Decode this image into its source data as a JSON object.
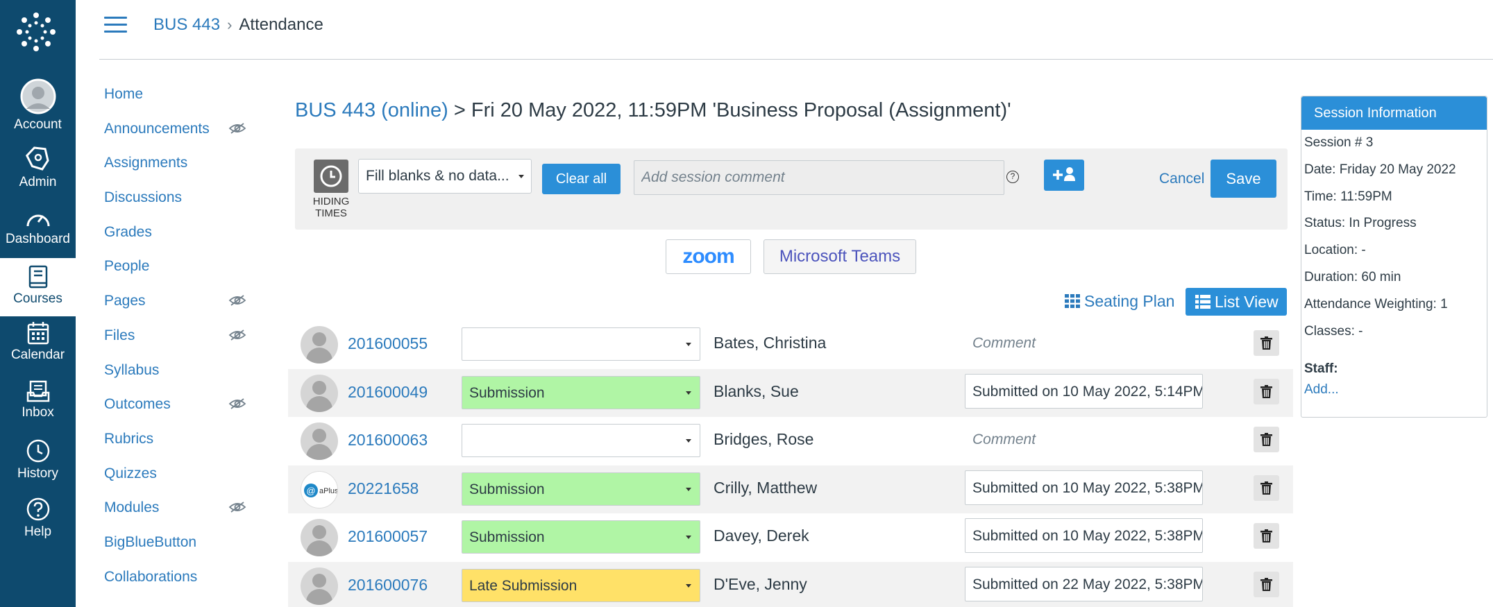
{
  "global_nav": {
    "items": [
      {
        "label": "Account",
        "icon": "account-avatar-icon"
      },
      {
        "label": "Admin",
        "icon": "admin-shield-icon"
      },
      {
        "label": "Dashboard",
        "icon": "dashboard-gauge-icon"
      },
      {
        "label": "Courses",
        "icon": "courses-book-icon",
        "active": true
      },
      {
        "label": "Calendar",
        "icon": "calendar-icon"
      },
      {
        "label": "Inbox",
        "icon": "inbox-icon"
      },
      {
        "label": "History",
        "icon": "history-clock-icon"
      },
      {
        "label": "Help",
        "icon": "help-question-icon"
      }
    ],
    "background": "#0e4a6e"
  },
  "header": {
    "course": "BUS 443",
    "separator": "›",
    "current": "Attendance"
  },
  "course_nav": {
    "items": [
      {
        "label": "Home",
        "hidden": false
      },
      {
        "label": "Announcements",
        "hidden": true
      },
      {
        "label": "Assignments",
        "hidden": false
      },
      {
        "label": "Discussions",
        "hidden": false
      },
      {
        "label": "Grades",
        "hidden": false
      },
      {
        "label": "People",
        "hidden": false
      },
      {
        "label": "Pages",
        "hidden": true
      },
      {
        "label": "Files",
        "hidden": true
      },
      {
        "label": "Syllabus",
        "hidden": false
      },
      {
        "label": "Outcomes",
        "hidden": true
      },
      {
        "label": "Rubrics",
        "hidden": false
      },
      {
        "label": "Quizzes",
        "hidden": false
      },
      {
        "label": "Modules",
        "hidden": true
      },
      {
        "label": "BigBlueButton",
        "hidden": false
      },
      {
        "label": "Collaborations",
        "hidden": false
      }
    ]
  },
  "main": {
    "title_link": "BUS 443 (online)",
    "title_rest": " > Fri 20 May 2022, 11:59PM 'Business Proposal (Assignment)'",
    "toolbar": {
      "hiding_times_label": "HIDING TIMES",
      "fill_select_value": "Fill blanks & no data...",
      "clear_all_label": "Clear all",
      "comment_placeholder": "Add session comment",
      "help_label": "?",
      "cancel_label": "Cancel",
      "save_label": "Save"
    },
    "meeting": {
      "zoom_label": "zoom",
      "teams_label": "Microsoft Teams"
    },
    "views": {
      "seating_label": "Seating Plan",
      "list_label": "List View"
    },
    "comment_placeholder": "Comment",
    "students": [
      {
        "id": "201600055",
        "status": "",
        "status_type": "none",
        "name": "Bates, Christina",
        "comment": "",
        "avatar": "default"
      },
      {
        "id": "201600049",
        "status": "Submission",
        "status_type": "sub",
        "name": "Blanks, Sue",
        "comment": "Submitted on 10 May 2022, 5:14PM",
        "avatar": "default"
      },
      {
        "id": "201600063",
        "status": "",
        "status_type": "none",
        "name": "Bridges, Rose",
        "comment": "",
        "avatar": "default"
      },
      {
        "id": "20221658",
        "status": "Submission",
        "status_type": "sub",
        "name": "Crilly, Matthew",
        "comment": "Submitted on 10 May 2022, 5:38PM",
        "avatar": "aplus"
      },
      {
        "id": "201600057",
        "status": "Submission",
        "status_type": "sub",
        "name": "Davey, Derek",
        "comment": "Submitted on 10 May 2022, 5:38PM",
        "avatar": "default"
      },
      {
        "id": "201600076",
        "status": "Late Submission",
        "status_type": "late",
        "name": "D'Eve, Jenny",
        "comment": "Submitted on 22 May 2022, 5:38PM",
        "avatar": "default"
      }
    ],
    "status_colors": {
      "sub": "#b0f5a5",
      "late": "#ffe168"
    }
  },
  "session_info": {
    "header": "Session Information",
    "lines": [
      "Session # 3",
      "Date: Friday 20 May 2022",
      "Time: 11:59PM",
      "Status: In Progress",
      "Location: -",
      "Duration: 60 min",
      "Attendance Weighting: 1",
      "Classes: -"
    ],
    "staff_label": "Staff:",
    "add_label": "Add..."
  }
}
